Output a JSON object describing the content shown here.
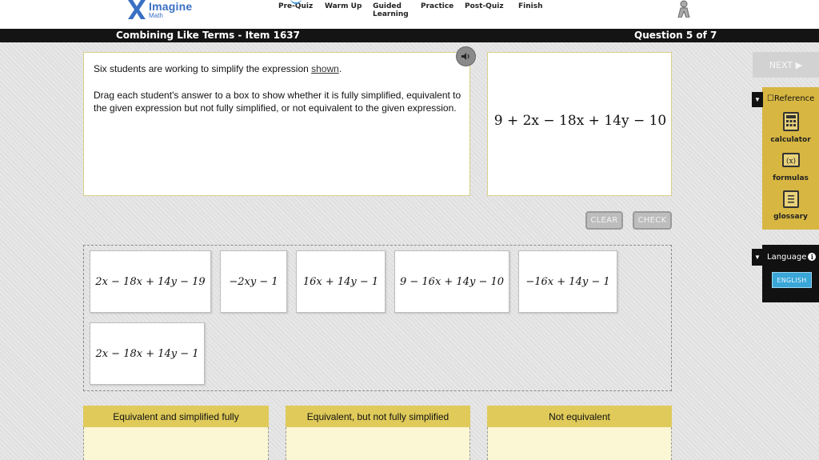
{
  "brand": {
    "name": "Imagine",
    "sub": "Math"
  },
  "nav": [
    {
      "label": "Pre-Quiz",
      "active": true
    },
    {
      "label": "Warm Up",
      "active": false
    },
    {
      "label": "Guided Learning",
      "active": false
    },
    {
      "label": "Practice",
      "active": false
    },
    {
      "label": "Post-Quiz",
      "active": false
    },
    {
      "label": "Finish",
      "active": false
    }
  ],
  "titlebar": {
    "lesson": "Combining Like Terms - Item 1637",
    "progress": "Question 5 of 7"
  },
  "question": {
    "line1_prefix": "Six students are working to simplify the expression ",
    "line1_link": "shown",
    "line1_suffix": ".",
    "line2": "Drag each student's answer to a box to show whether it is fully simplified, equivalent to the given expression but not fully simplified, or not equivalent to the given expression."
  },
  "expression": "9 + 2x − 18x + 14y − 10",
  "buttons": {
    "clear": "CLEAR",
    "check": "CHECK",
    "next": "NEXT ▶"
  },
  "reference": {
    "title": "Reference",
    "items": [
      {
        "label": "calculator",
        "icon": "calculator-icon"
      },
      {
        "label": "formulas",
        "icon": "formulas-icon"
      },
      {
        "label": "glossary",
        "icon": "glossary-icon"
      }
    ]
  },
  "language": {
    "title": "Language",
    "button": "ENGLISH"
  },
  "tiles": [
    "2x − 18x + 14y − 19",
    "−2xy − 1",
    "16x + 14y − 1",
    "9 − 16x + 14y − 10",
    "−16x + 14y − 1",
    "2x − 18x + 14y − 1"
  ],
  "zones": [
    "Equivalent and simplified fully",
    "Equivalent, but not fully simplified",
    "Not equivalent"
  ],
  "colors": {
    "accent": "#dfca5a",
    "titlebar": "#141414",
    "language_button": "#3aa6d8",
    "brand": "#3a6fc4"
  }
}
